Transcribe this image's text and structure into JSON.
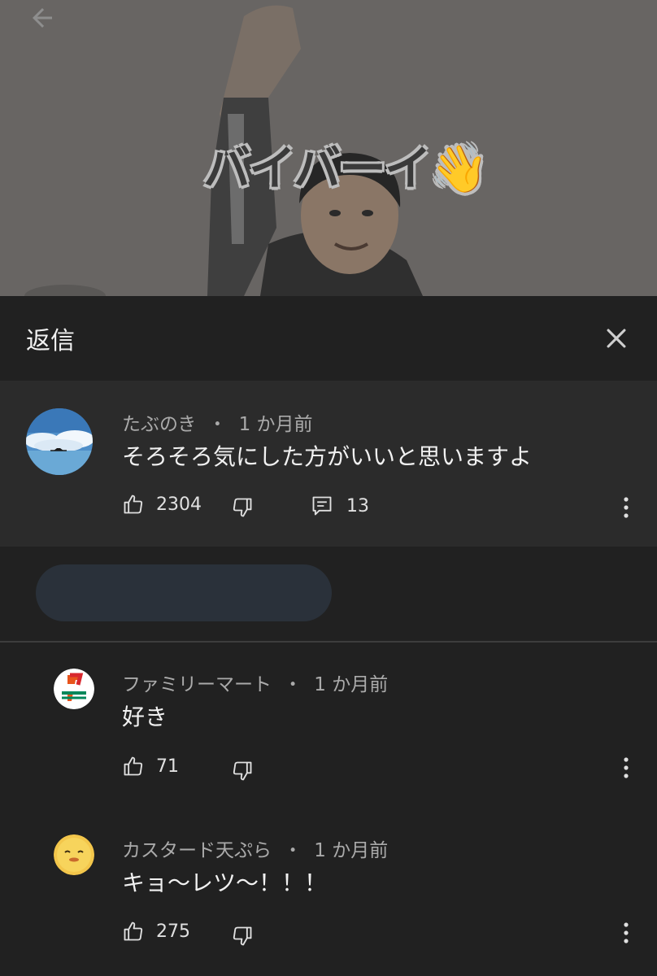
{
  "video": {
    "caption": "バイバーイ👋"
  },
  "panel": {
    "title": "返信"
  },
  "parent_comment": {
    "author": "たぶのき",
    "time": "1 か月前",
    "text": "そろそろ気にした方がいいと思いますよ",
    "likes": "2304",
    "replies": "13"
  },
  "replies": [
    {
      "author": "ファミリーマート",
      "time": "1 か月前",
      "text": "好き",
      "likes": "71"
    },
    {
      "author": "カスタード天ぷら",
      "time": "1 か月前",
      "text": "キョ〜レツ〜！！！",
      "likes": "275"
    }
  ],
  "icons": {
    "back": "arrow-left-icon",
    "close": "close-icon",
    "like": "thumbs-up-icon",
    "dislike": "thumbs-down-icon",
    "reply": "comment-icon",
    "more": "more-vert-icon"
  },
  "colors": {
    "background": "#212121",
    "parent_background": "#2b2b2b",
    "secondary_text": "#aaaaaa"
  }
}
